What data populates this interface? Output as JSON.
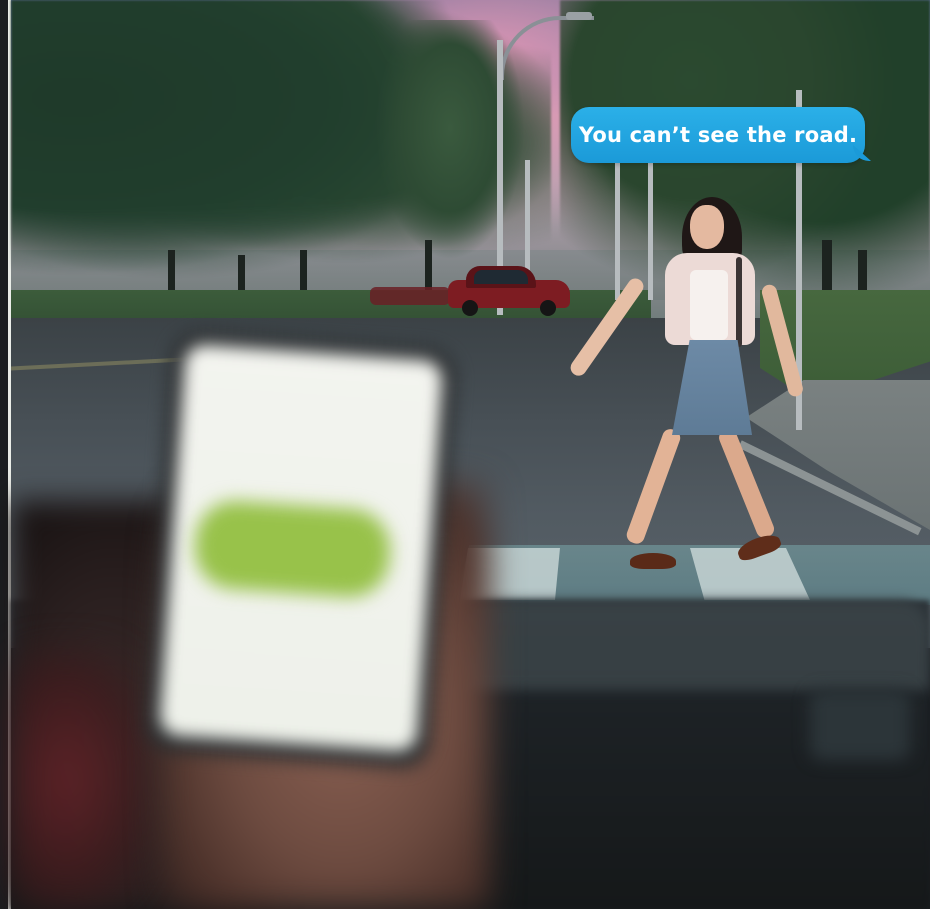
{
  "bubble": {
    "text": "You can’t see the road.",
    "color": "#1b9ad8"
  },
  "phone": {
    "message_color": "#98c24a"
  }
}
